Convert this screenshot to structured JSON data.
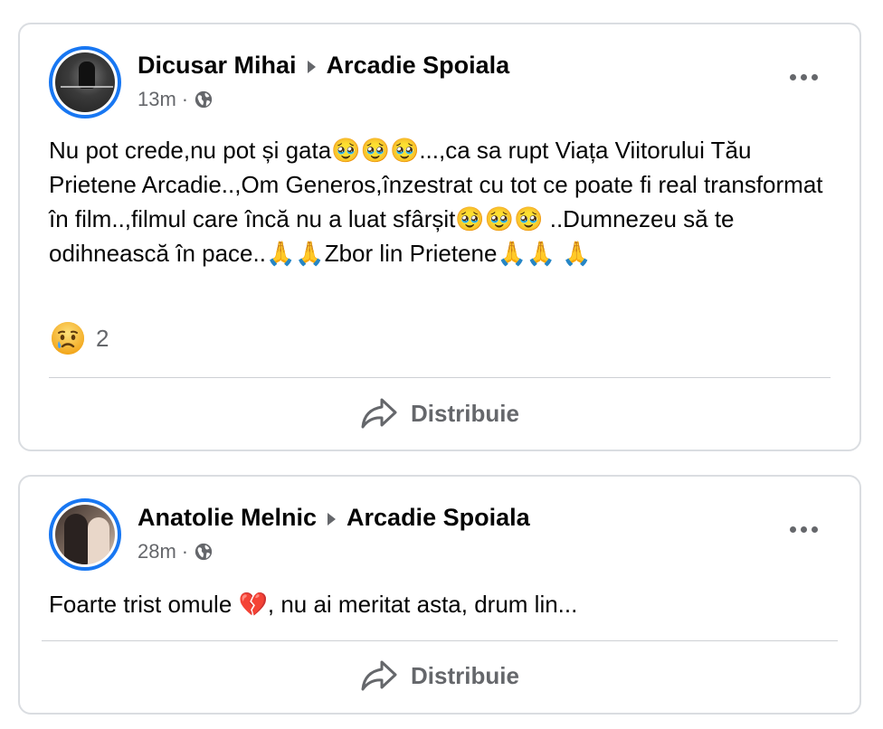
{
  "posts": [
    {
      "author": "Dicusar Mihai",
      "target": "Arcadie Spoiala",
      "time": "13m",
      "separator": "·",
      "text": "Nu pot crede,nu pot și gata🥹🥹🥹...,ca sa rupt Viața Viitorului Tău Prietene Arcadie..,Om Generos,înzestrat cu tot ce poate fi real transformat în film..,filmul care încă nu a luat sfârșit🥹🥹🥹 ..Dumnezeu să te odihnească în pace..🙏🙏Zbor lin Prietene🙏🙏 🙏",
      "reaction_count": "2",
      "share_label": "Distribuie"
    },
    {
      "author": "Anatolie Melnic",
      "target": "Arcadie Spoiala",
      "time": "28m",
      "separator": "·",
      "text": "Foarte trist omule 💔, nu ai meritat asta, drum lin...",
      "share_label": "Distribuie"
    }
  ],
  "icons": {
    "privacy": "globe-icon",
    "more": "more-options-icon",
    "share": "share-arrow-icon",
    "reaction": "sad-reaction-icon"
  },
  "colors": {
    "accent": "#1877f2",
    "secondary_text": "#65676b",
    "border": "#dadde1",
    "divider": "#ced0d4"
  }
}
